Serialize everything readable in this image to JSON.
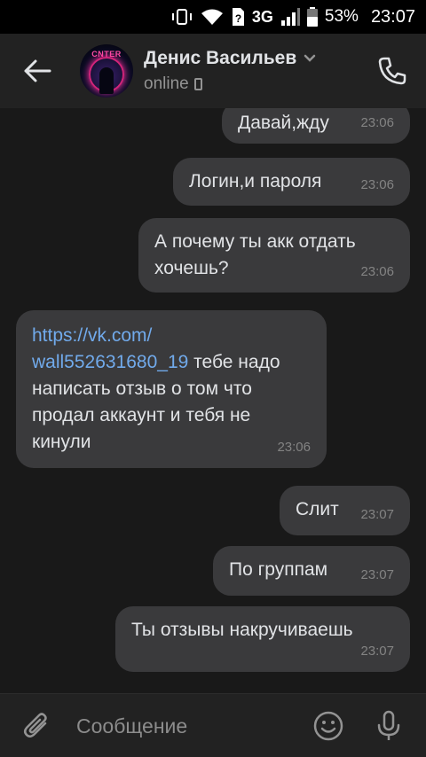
{
  "status_bar": {
    "network": "3G",
    "battery": "53%",
    "time": "23:07"
  },
  "header": {
    "contact_name": "Денис Васильев",
    "status": "online",
    "avatar_text": "CNTER",
    "icons": [
      "back-arrow-icon",
      "chevron-down-icon",
      "mobile-phone-icon",
      "phone-call-icon"
    ]
  },
  "messages": [
    {
      "direction": "outgoing",
      "text": "Давай,жду",
      "time": "23:06"
    },
    {
      "direction": "outgoing",
      "text": "Логин,и пароля",
      "time": "23:06"
    },
    {
      "direction": "outgoing",
      "text_line1": "А почему ты акк отдать",
      "text_line2": "хочешь?",
      "time": "23:06"
    },
    {
      "direction": "incoming",
      "link_line1": "https://vk.com/",
      "link_line2": "wall552631680_19",
      "text_line2_rest": " тебе надо",
      "text_line3": "написать отзыв о том что",
      "text_line4": "продал аккаунт и тебя не",
      "text_line5": "кинули",
      "time": "23:06"
    },
    {
      "direction": "outgoing",
      "text": "Слит",
      "time": "23:07"
    },
    {
      "direction": "outgoing",
      "text": "По группам",
      "time": "23:07"
    },
    {
      "direction": "outgoing",
      "text": "Ты отзывы накручиваешь",
      "time": "23:07"
    }
  ],
  "input_bar": {
    "placeholder": "Сообщение",
    "icons": [
      "paperclip-icon",
      "emoji-icon",
      "microphone-icon"
    ]
  },
  "colors": {
    "background": "#191919",
    "header": "#222222",
    "bubble": "#3a3a3c",
    "link": "#71aaeb",
    "time": "#838383"
  }
}
